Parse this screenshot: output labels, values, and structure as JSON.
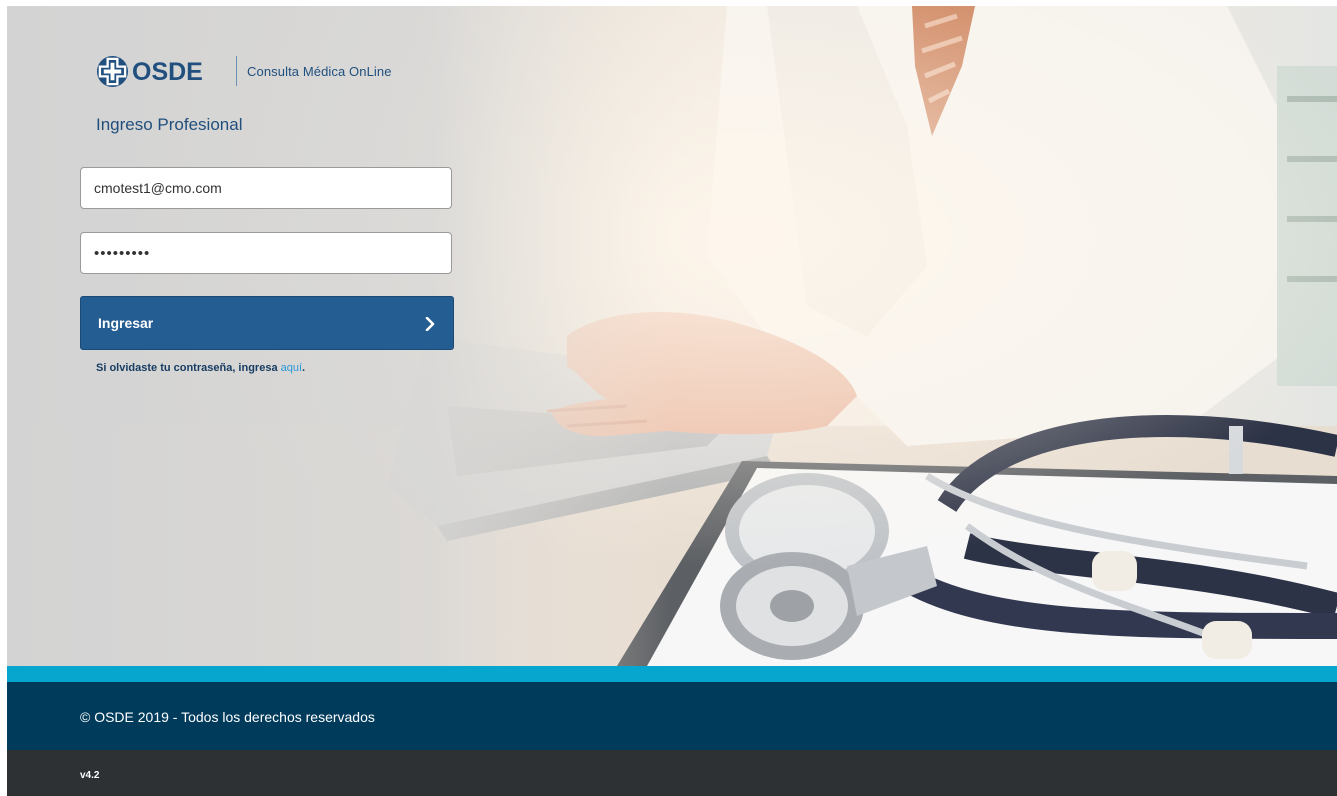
{
  "brand": {
    "logo_text": "OSDE",
    "subtitle": "Consulta Médica OnLine",
    "colors": {
      "primary": "#245d91",
      "title": "#214f7d",
      "accent": "#07a6cf",
      "footer": "#003b5c",
      "version_bar": "#2e3134",
      "link": "#2a97d8"
    }
  },
  "login": {
    "title": "Ingreso Profesional",
    "email_value": "cmotest1@cmo.com",
    "password_value": "•••••••••",
    "submit_label": "Ingresar",
    "submit_icon": "chevron-right-icon",
    "forgot_text": "Si olvidaste tu contraseña, ingresa ",
    "forgot_link": "aquí",
    "forgot_end": "."
  },
  "footer": {
    "copyright": "© OSDE 2019 - Todos los derechos reservados",
    "version": "v4.2"
  },
  "background": {
    "image": "doctor-typing-laptop-with-stethoscope"
  }
}
